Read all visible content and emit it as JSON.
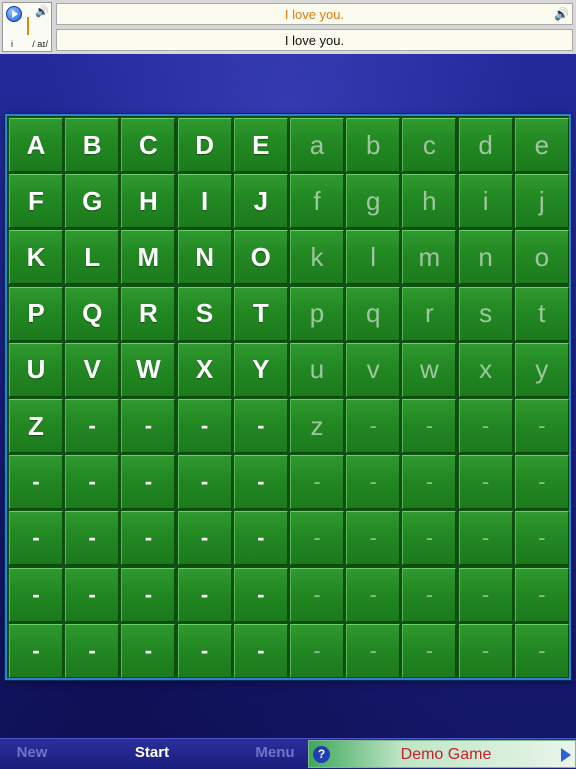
{
  "phonetic": {
    "letter": "i",
    "ipa": "/ aɪ/"
  },
  "sentences": {
    "line1": "I love you.",
    "line2": "I love you."
  },
  "board": {
    "rows": [
      [
        "A",
        "B",
        "C",
        "D",
        "E",
        "a",
        "b",
        "c",
        "d",
        "e"
      ],
      [
        "F",
        "G",
        "H",
        "I",
        "J",
        "f",
        "g",
        "h",
        "i",
        "j"
      ],
      [
        "K",
        "L",
        "M",
        "N",
        "O",
        "k",
        "l",
        "m",
        "n",
        "o"
      ],
      [
        "P",
        "Q",
        "R",
        "S",
        "T",
        "p",
        "q",
        "r",
        "s",
        "t"
      ],
      [
        "U",
        "V",
        "W",
        "X",
        "Y",
        "u",
        "v",
        "w",
        "x",
        "y"
      ],
      [
        "Z",
        "-",
        "-",
        "-",
        "-",
        "z",
        "-",
        "-",
        "-",
        "-"
      ],
      [
        "-",
        "-",
        "-",
        "-",
        "-",
        "-",
        "-",
        "-",
        "-",
        "-"
      ],
      [
        "-",
        "-",
        "-",
        "-",
        "-",
        "-",
        "-",
        "-",
        "-",
        "-"
      ],
      [
        "-",
        "-",
        "-",
        "-",
        "-",
        "-",
        "-",
        "-",
        "-",
        "-"
      ],
      [
        "-",
        "-",
        "-",
        "-",
        "-",
        "-",
        "-",
        "-",
        "-",
        "-"
      ]
    ]
  },
  "bottombar": {
    "new_label": "New",
    "start_label": "Start",
    "menu_label": "Menu",
    "demo_label": "Demo Game",
    "help_symbol": "?"
  },
  "colors": {
    "tile_green": "#228822",
    "upper_text": "#ffffff",
    "lower_text": "#9fc79f",
    "demo_text": "#c8202a",
    "highlight_orange": "#e07a10"
  }
}
